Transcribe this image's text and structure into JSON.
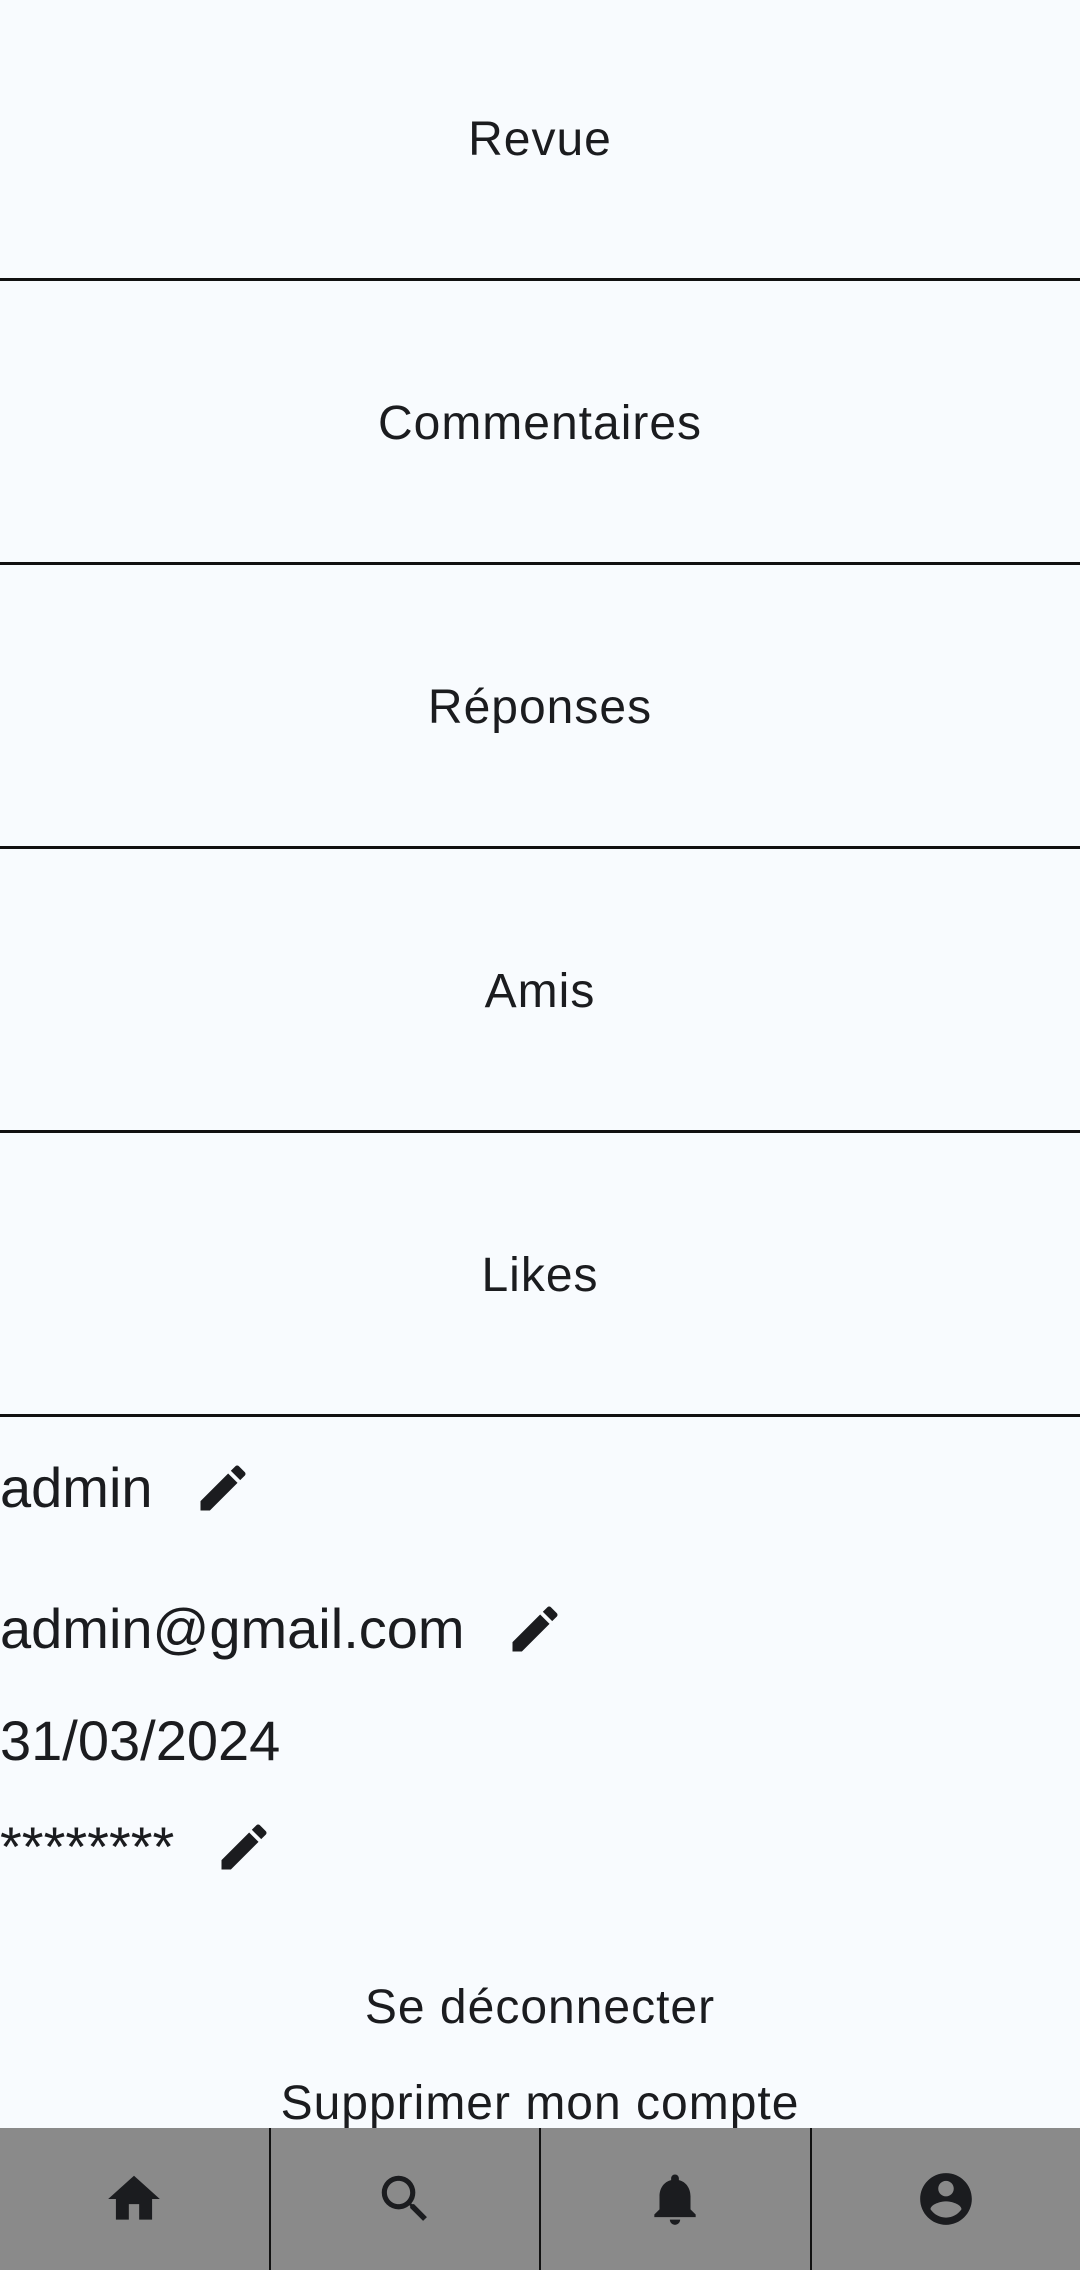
{
  "menu": {
    "items": [
      {
        "label": "Revue"
      },
      {
        "label": "Commentaires"
      },
      {
        "label": "Réponses"
      },
      {
        "label": "Amis"
      },
      {
        "label": "Likes"
      }
    ]
  },
  "profile": {
    "username": "admin",
    "email": "admin@gmail.com",
    "date": "31/03/2024",
    "password": "********"
  },
  "actions": {
    "logout": "Se déconnecter",
    "delete_account": "Supprimer mon compte"
  },
  "icons": {
    "edit": "pencil-icon",
    "nav": [
      "home-icon",
      "search-icon",
      "bell-icon",
      "account-icon"
    ]
  },
  "colors": {
    "background": "#f8fbfe",
    "navbar": "#8a8a8a",
    "text": "#1b1c1f"
  }
}
